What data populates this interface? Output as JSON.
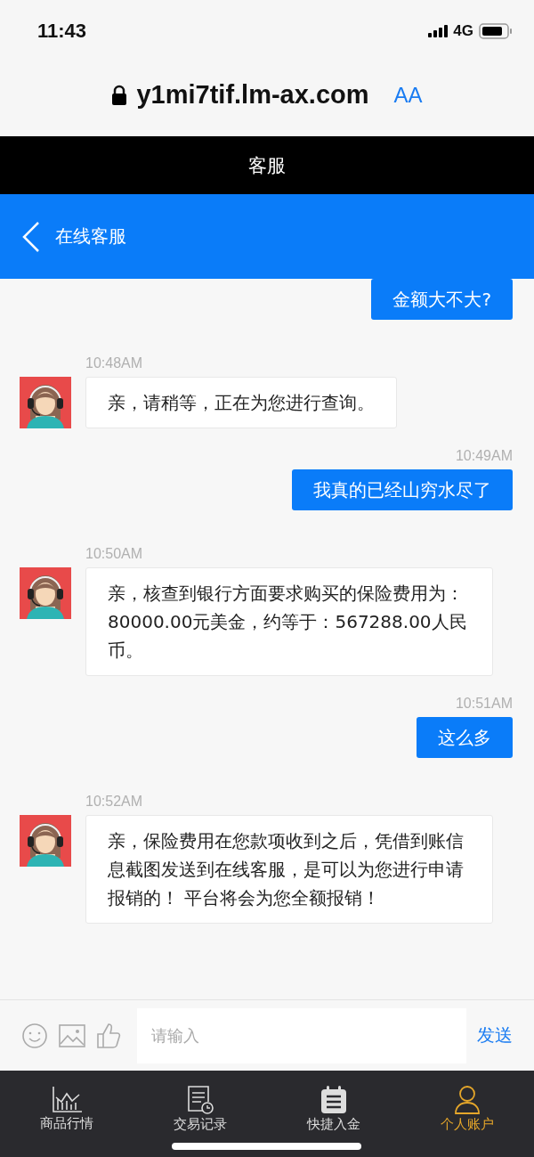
{
  "status_bar": {
    "time": "11:43",
    "network": "4G"
  },
  "browser": {
    "url": "y1mi7tif.lm-ax.com",
    "text_size_button": "AA"
  },
  "page_title": "客服",
  "header": {
    "title": "在线客服"
  },
  "messages": [
    {
      "kind": "user",
      "text": "金额大不大?"
    },
    {
      "kind": "agent",
      "time": "10:48AM",
      "text": "亲，请稍等，正在为您进行查询。"
    },
    {
      "kind": "user",
      "time": "10:49AM",
      "text": "我真的已经山穷水尽了"
    },
    {
      "kind": "agent",
      "time": "10:50AM",
      "text": "亲，核查到银行方面要求购买的保险费用为：80000.00元美金，约等于：567288.00人民币。"
    },
    {
      "kind": "user",
      "time": "10:51AM",
      "text": "这么多"
    },
    {
      "kind": "agent",
      "time": "10:52AM",
      "text": "亲，保险费用在您款项收到之后，凭借到账信息截图发送到在线客服，是可以为您进行申请报销的！ 平台将会为您全额报销！"
    }
  ],
  "composer": {
    "placeholder": "请输入",
    "send": "发送"
  },
  "tabs": [
    {
      "kind": "chart",
      "label": "商品行情",
      "selected": false
    },
    {
      "kind": "record",
      "label": "交易记录",
      "selected": false
    },
    {
      "kind": "note",
      "label": "快捷入金",
      "selected": false
    },
    {
      "kind": "person",
      "label": "个人账户",
      "selected": true
    }
  ]
}
